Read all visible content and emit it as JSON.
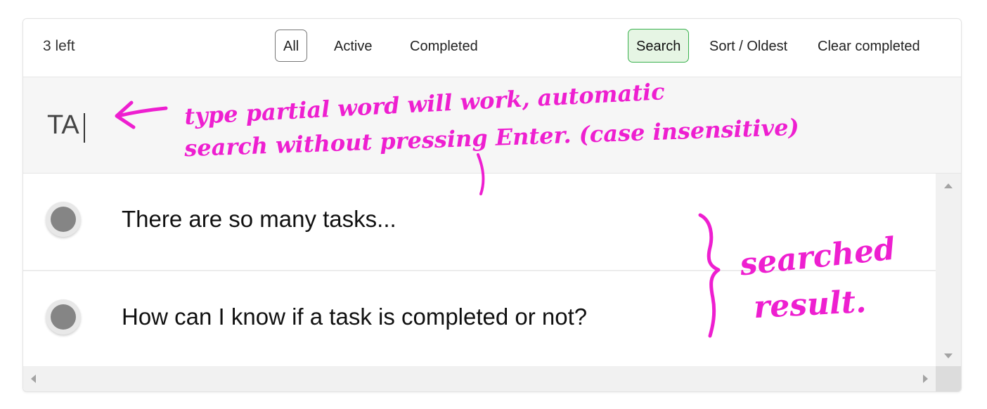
{
  "toolbar": {
    "count_label": "3 left",
    "filters": {
      "all": "All",
      "active": "Active",
      "completed": "Completed"
    },
    "selected_filter": "All",
    "search_label": "Search",
    "sort_label": "Sort / Oldest",
    "clear_label": "Clear completed"
  },
  "search": {
    "value": "TA"
  },
  "tasks": [
    {
      "text": "There are so many tasks..."
    },
    {
      "text": "How can I know if a task is completed or not?"
    }
  ],
  "annotations": {
    "search_note_line1": "type partial word will work, automatic",
    "search_note_line2": "search without pressing Enter. (case insensitive)",
    "result_note_line1": "searched",
    "result_note_line2": "result."
  },
  "colors": {
    "annotation": "#ee1fd0",
    "search_active_border": "#39b14d",
    "search_active_bg": "#e6f5e4"
  }
}
